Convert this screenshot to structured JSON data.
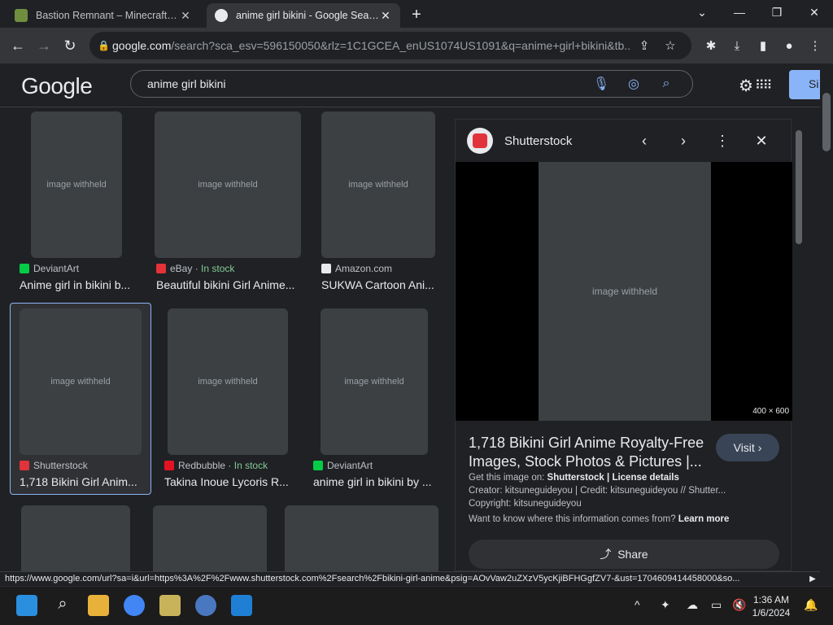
{
  "browser": {
    "tabs": [
      {
        "title": "Bastion Remnant – Minecraft Wi",
        "active": false
      },
      {
        "title": "anime girl bikini - Google Search",
        "active": true
      }
    ],
    "url_domain": "google.com",
    "url_rest": "/search?sca_esv=596150050&rlz=1C1GCEA_enUS1074US1091&q=anime+girl+bikini&tb..."
  },
  "google": {
    "logo": "Google",
    "query": "anime girl bikini",
    "signin_label": "Si"
  },
  "results": [
    {
      "source": "DeviantArt",
      "stock": "",
      "caption": "Anime girl in bikini b..."
    },
    {
      "source": "eBay",
      "stock": "In stock",
      "caption": "Beautiful bikini Girl Anime..."
    },
    {
      "source": "Amazon.com",
      "stock": "",
      "caption": "SUKWA Cartoon Ani..."
    },
    {
      "source": "Shutterstock",
      "stock": "",
      "caption": "1,718 Bikini Girl Anim..."
    },
    {
      "source": "Redbubble",
      "stock": "In stock",
      "caption": "Takina Inoue Lycoris R..."
    },
    {
      "source": "DeviantArt",
      "stock": "",
      "caption": "anime girl in bikini by ..."
    }
  ],
  "panel": {
    "source_name": "Shutterstock",
    "dims": "400 × 600",
    "title": "1,718 Bikini Girl Anime Royalty-Free Images, Stock Photos & Pictures |...",
    "visit_label": "Visit",
    "get_image_prefix": "Get this image on: ",
    "get_image_source": "Shutterstock",
    "get_image_sep": " | ",
    "license_label": "License details",
    "creator": "Creator: kitsuneguideyou | Credit: kitsuneguideyou // Shutter...",
    "copyright": "Copyright: kitsuneguideyou",
    "info_question": "Want to know where this information comes from? ",
    "learn_more": "Learn more",
    "share_label": "Share"
  },
  "status_url": "https://www.google.com/url?sa=i&url=https%3A%2F%2Fwww.shutterstock.com%2Fsearch%2Fbikini-girl-anime&psig=AOvVaw2uZXzV5ycKjiBFHGgfZV7-&ust=1704609414458000&so...",
  "taskbar": {
    "time": "1:36 AM",
    "date": "1/6/2024"
  },
  "placeholder_label": "image withheld",
  "colors": {
    "accent": "#8ab4f8",
    "stock_green": "#81c995",
    "shutterstock_red": "#e0333b"
  }
}
